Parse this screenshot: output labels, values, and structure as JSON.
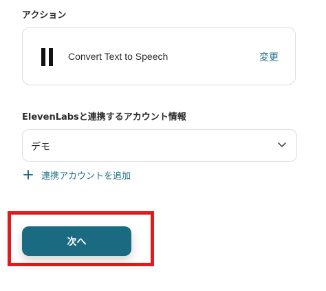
{
  "action_section": {
    "label": "アクション",
    "action_title": "Convert Text to Speech",
    "change_label": "変更",
    "logo_icon": "elevenlabs-logo-icon"
  },
  "account_section": {
    "label": "ElevenLabsと連携するアカウント情報",
    "selected_account": "デモ",
    "add_account_label": "連携アカウントを追加"
  },
  "footer": {
    "next_label": "次へ"
  },
  "colors": {
    "accent": "#1e6f8a",
    "button": "#1a6a82",
    "highlight": "#e01b1b"
  }
}
